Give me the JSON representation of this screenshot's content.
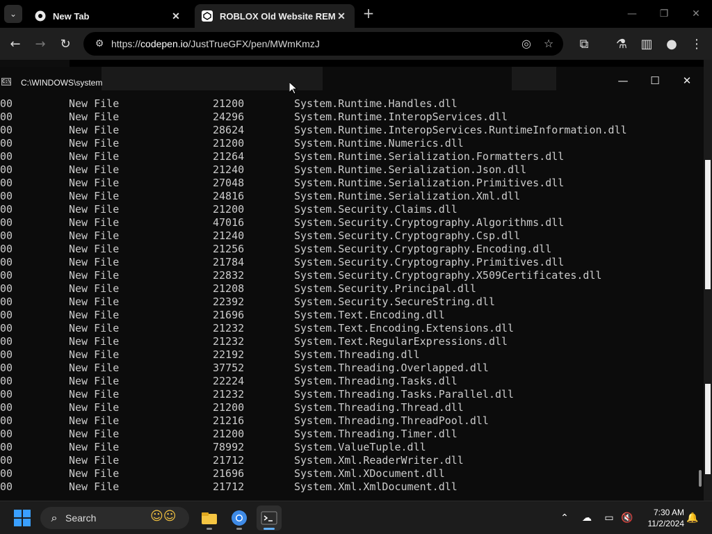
{
  "browser": {
    "tabs": [
      {
        "title": "New Tab",
        "favicon": "chrome-icon"
      },
      {
        "title": "ROBLOX Old Website REMAKE",
        "favicon": "codepen-icon"
      }
    ],
    "url_scheme": "https://",
    "url_host": "codepen.io",
    "url_path": "/JustTrueGFX/pen/MWmKmzJ"
  },
  "console": {
    "title": "C:\\WINDOWS\\system",
    "rows": [
      {
        "status": "New File",
        "size": "21200",
        "name": "System.Runtime.Handles.dll"
      },
      {
        "status": "New File",
        "size": "24296",
        "name": "System.Runtime.InteropServices.dll"
      },
      {
        "status": "New File",
        "size": "28624",
        "name": "System.Runtime.InteropServices.RuntimeInformation.dll"
      },
      {
        "status": "New File",
        "size": "21200",
        "name": "System.Runtime.Numerics.dll"
      },
      {
        "status": "New File",
        "size": "21264",
        "name": "System.Runtime.Serialization.Formatters.dll"
      },
      {
        "status": "New File",
        "size": "21240",
        "name": "System.Runtime.Serialization.Json.dll"
      },
      {
        "status": "New File",
        "size": "27048",
        "name": "System.Runtime.Serialization.Primitives.dll"
      },
      {
        "status": "New File",
        "size": "24816",
        "name": "System.Runtime.Serialization.Xml.dll"
      },
      {
        "status": "New File",
        "size": "21200",
        "name": "System.Security.Claims.dll"
      },
      {
        "status": "New File",
        "size": "47016",
        "name": "System.Security.Cryptography.Algorithms.dll"
      },
      {
        "status": "New File",
        "size": "21240",
        "name": "System.Security.Cryptography.Csp.dll"
      },
      {
        "status": "New File",
        "size": "21256",
        "name": "System.Security.Cryptography.Encoding.dll"
      },
      {
        "status": "New File",
        "size": "21784",
        "name": "System.Security.Cryptography.Primitives.dll"
      },
      {
        "status": "New File",
        "size": "22832",
        "name": "System.Security.Cryptography.X509Certificates.dll"
      },
      {
        "status": "New File",
        "size": "21208",
        "name": "System.Security.Principal.dll"
      },
      {
        "status": "New File",
        "size": "22392",
        "name": "System.Security.SecureString.dll"
      },
      {
        "status": "New File",
        "size": "21696",
        "name": "System.Text.Encoding.dll"
      },
      {
        "status": "New File",
        "size": "21232",
        "name": "System.Text.Encoding.Extensions.dll"
      },
      {
        "status": "New File",
        "size": "21232",
        "name": "System.Text.RegularExpressions.dll"
      },
      {
        "status": "New File",
        "size": "22192",
        "name": "System.Threading.dll"
      },
      {
        "status": "New File",
        "size": "37752",
        "name": "System.Threading.Overlapped.dll"
      },
      {
        "status": "New File",
        "size": "22224",
        "name": "System.Threading.Tasks.dll"
      },
      {
        "status": "New File",
        "size": "21232",
        "name": "System.Threading.Tasks.Parallel.dll"
      },
      {
        "status": "New File",
        "size": "21200",
        "name": "System.Threading.Thread.dll"
      },
      {
        "status": "New File",
        "size": "21216",
        "name": "System.Threading.ThreadPool.dll"
      },
      {
        "status": "New File",
        "size": "21200",
        "name": "System.Threading.Timer.dll"
      },
      {
        "status": "New File",
        "size": "78992",
        "name": "System.ValueTuple.dll"
      },
      {
        "status": "New File",
        "size": "21712",
        "name": "System.Xml.ReaderWriter.dll"
      },
      {
        "status": "New File",
        "size": "21696",
        "name": "System.Xml.XDocument.dll"
      },
      {
        "status": "New File",
        "size": "21712",
        "name": "System.Xml.XmlDocument.dll"
      }
    ],
    "prefix": "00"
  },
  "taskbar": {
    "search_label": "Search",
    "time": "7:30 AM",
    "date": "11/2/2024"
  },
  "colors": {
    "console_bg": "#0c0c0c",
    "console_text": "#cccccc",
    "accent": "#3aa0ff"
  }
}
